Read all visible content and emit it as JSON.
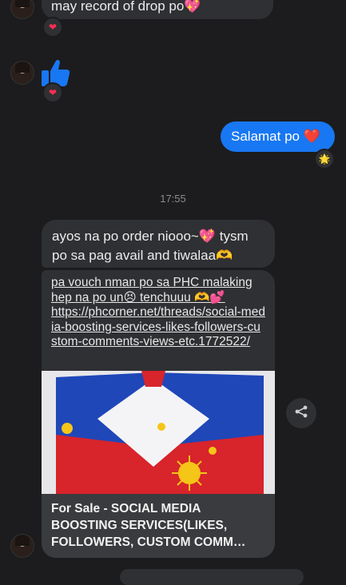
{
  "messages": {
    "top_partial": "may record of drop po💖",
    "like_reaction": "❤",
    "top_reaction": "❤",
    "outgoing": {
      "text": "Salamat po ❤️",
      "reaction": "🌟"
    },
    "timestamp": "17:55",
    "incoming1": "ayos na po order niooo~💖 tysm po sa pag avail and tiwalaa🫶",
    "incoming2": {
      "text": "pa vouch nman po sa PHC malaking hep na po un😣 tenchuuu 🫶💕",
      "url": "https://phcorner.net/threads/social-media-boosting-services-likes-followers-custom-comments-views-etc.1772522/",
      "preview_title": "For Sale - SOCIAL MEDIA BOOSTING SERVICES(LIKES, FOLLOWERS, CUSTOM COMM…"
    }
  },
  "icons": {
    "thumbs_up": "thumbs-up-icon",
    "share": "share-icon"
  },
  "colors": {
    "background": "#1c1c1e",
    "incoming_bubble": "#2f3033",
    "outgoing_bubble": "#1877f2",
    "heart": "#ff2d55",
    "flag_blue": "#1f47b8",
    "flag_red": "#d8242b",
    "flag_sun": "#f5c518"
  }
}
